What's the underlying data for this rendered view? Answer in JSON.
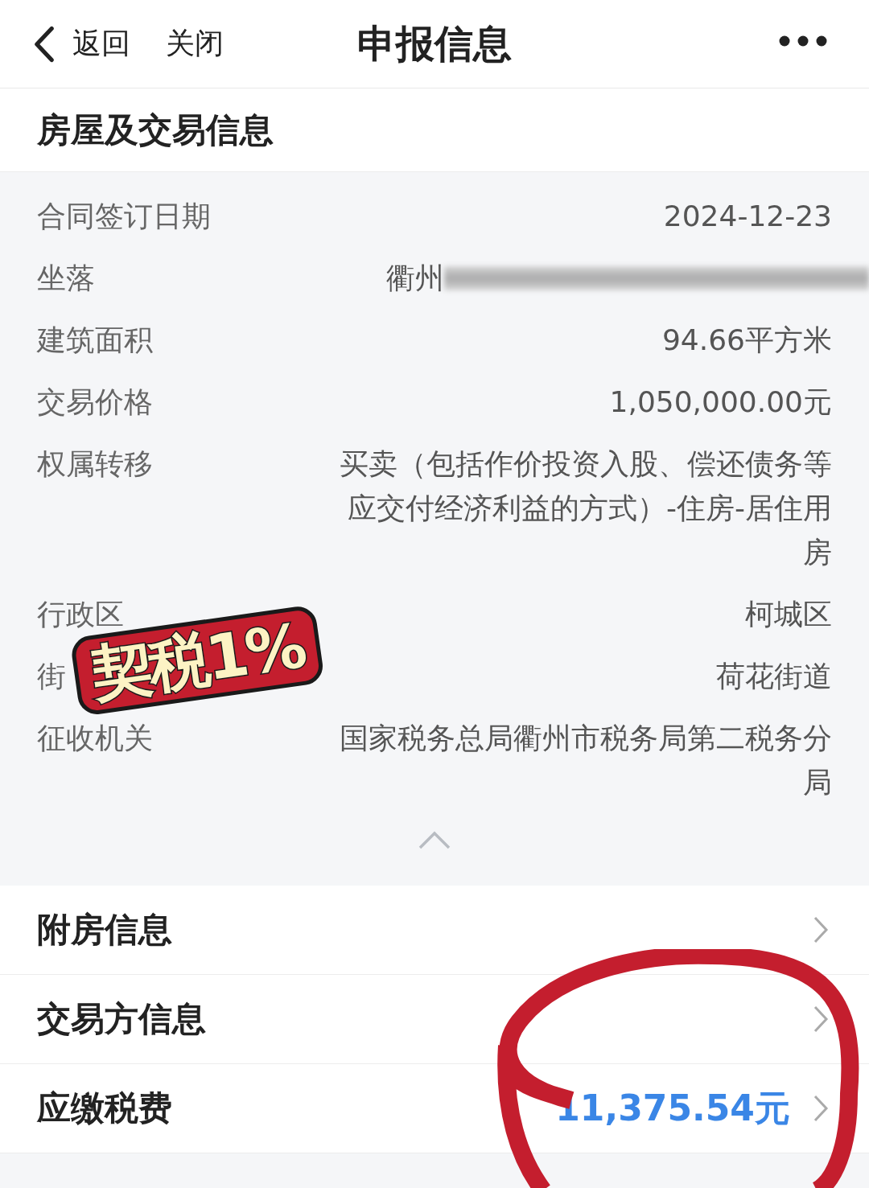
{
  "nav": {
    "back": "返回",
    "close": "关闭",
    "title": "申报信息"
  },
  "section": {
    "title": "房屋及交易信息",
    "expanded": true
  },
  "rows": [
    {
      "label": "合同签订日期",
      "value": "2024-12-23",
      "kind": "text"
    },
    {
      "label": "坐落",
      "value": "衢州",
      "kind": "redacted"
    },
    {
      "label": "建筑面积",
      "value": "94.66平方米",
      "kind": "text"
    },
    {
      "label": "交易价格",
      "value": "1,050,000.00元",
      "kind": "text"
    },
    {
      "label": "权属转移",
      "value": "买卖（包括作价投资入股、偿还债务等应交付经济利益的方式）-住房-居住用房",
      "kind": "text"
    },
    {
      "label": "行政区",
      "value": "柯城区",
      "kind": "text"
    },
    {
      "label": "街",
      "value": "荷花街道",
      "kind": "text"
    },
    {
      "label": "征收机关",
      "value": "国家税务总局衢州市税务局第二税务分局",
      "kind": "text"
    }
  ],
  "sticker": {
    "text": "契税1%"
  },
  "links": [
    {
      "label": "附房信息"
    },
    {
      "label": "交易方信息"
    },
    {
      "label": "应缴税费",
      "value": "11,375.54元"
    }
  ]
}
